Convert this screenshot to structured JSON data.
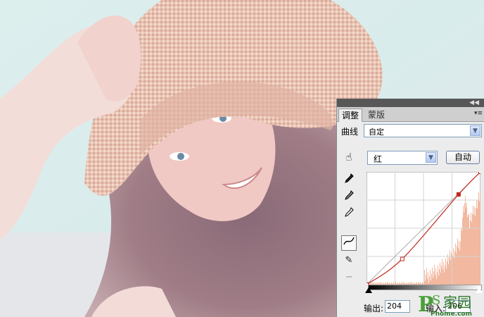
{
  "panel": {
    "tabs": [
      {
        "label": "调整",
        "active": true
      },
      {
        "label": "蒙版",
        "active": false
      }
    ],
    "preset": {
      "label": "曲线",
      "value": "自定"
    },
    "channel": {
      "value": "红"
    },
    "auto_label": "自动",
    "output": {
      "label": "输出:",
      "value": "204"
    },
    "input": {
      "label": "输入:",
      "value": "206"
    }
  },
  "curve": {
    "channel_color": "#c0261c",
    "histogram_color": "#f2b8a0",
    "control_points": [
      {
        "input": 0,
        "output": 0
      },
      {
        "input": 80,
        "output": 58
      },
      {
        "input": 206,
        "output": 204
      },
      {
        "input": 255,
        "output": 255
      }
    ]
  },
  "watermark": {
    "text": "PS 家园",
    "sub": "Phome.com"
  },
  "icons": [
    "collapse-icon",
    "panel-menu-icon",
    "target-adjust-icon",
    "eyedropper-black-icon",
    "eyedropper-gray-icon",
    "eyedropper-white-icon",
    "curve-edit-icon",
    "pencil-icon",
    "smooth-icon",
    "dropdown-arrow-icon"
  ]
}
